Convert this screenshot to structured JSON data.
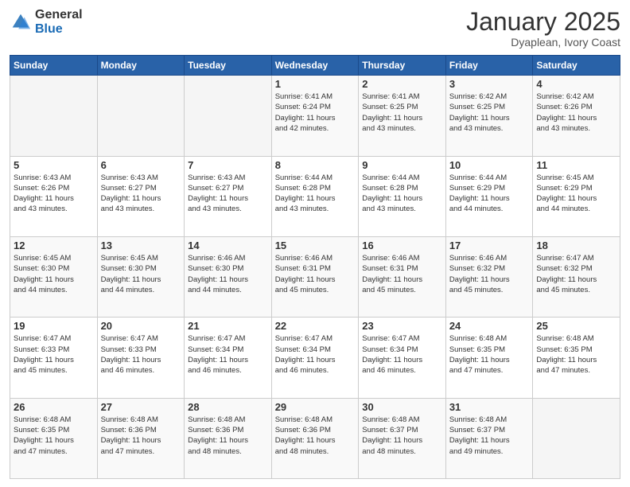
{
  "logo": {
    "general": "General",
    "blue": "Blue"
  },
  "title": {
    "month": "January 2025",
    "location": "Dyaplean, Ivory Coast"
  },
  "weekdays": [
    "Sunday",
    "Monday",
    "Tuesday",
    "Wednesday",
    "Thursday",
    "Friday",
    "Saturday"
  ],
  "weeks": [
    [
      {
        "day": "",
        "info": ""
      },
      {
        "day": "",
        "info": ""
      },
      {
        "day": "",
        "info": ""
      },
      {
        "day": "1",
        "info": "Sunrise: 6:41 AM\nSunset: 6:24 PM\nDaylight: 11 hours\nand 42 minutes."
      },
      {
        "day": "2",
        "info": "Sunrise: 6:41 AM\nSunset: 6:25 PM\nDaylight: 11 hours\nand 43 minutes."
      },
      {
        "day": "3",
        "info": "Sunrise: 6:42 AM\nSunset: 6:25 PM\nDaylight: 11 hours\nand 43 minutes."
      },
      {
        "day": "4",
        "info": "Sunrise: 6:42 AM\nSunset: 6:26 PM\nDaylight: 11 hours\nand 43 minutes."
      }
    ],
    [
      {
        "day": "5",
        "info": "Sunrise: 6:43 AM\nSunset: 6:26 PM\nDaylight: 11 hours\nand 43 minutes."
      },
      {
        "day": "6",
        "info": "Sunrise: 6:43 AM\nSunset: 6:27 PM\nDaylight: 11 hours\nand 43 minutes."
      },
      {
        "day": "7",
        "info": "Sunrise: 6:43 AM\nSunset: 6:27 PM\nDaylight: 11 hours\nand 43 minutes."
      },
      {
        "day": "8",
        "info": "Sunrise: 6:44 AM\nSunset: 6:28 PM\nDaylight: 11 hours\nand 43 minutes."
      },
      {
        "day": "9",
        "info": "Sunrise: 6:44 AM\nSunset: 6:28 PM\nDaylight: 11 hours\nand 43 minutes."
      },
      {
        "day": "10",
        "info": "Sunrise: 6:44 AM\nSunset: 6:29 PM\nDaylight: 11 hours\nand 44 minutes."
      },
      {
        "day": "11",
        "info": "Sunrise: 6:45 AM\nSunset: 6:29 PM\nDaylight: 11 hours\nand 44 minutes."
      }
    ],
    [
      {
        "day": "12",
        "info": "Sunrise: 6:45 AM\nSunset: 6:30 PM\nDaylight: 11 hours\nand 44 minutes."
      },
      {
        "day": "13",
        "info": "Sunrise: 6:45 AM\nSunset: 6:30 PM\nDaylight: 11 hours\nand 44 minutes."
      },
      {
        "day": "14",
        "info": "Sunrise: 6:46 AM\nSunset: 6:30 PM\nDaylight: 11 hours\nand 44 minutes."
      },
      {
        "day": "15",
        "info": "Sunrise: 6:46 AM\nSunset: 6:31 PM\nDaylight: 11 hours\nand 45 minutes."
      },
      {
        "day": "16",
        "info": "Sunrise: 6:46 AM\nSunset: 6:31 PM\nDaylight: 11 hours\nand 45 minutes."
      },
      {
        "day": "17",
        "info": "Sunrise: 6:46 AM\nSunset: 6:32 PM\nDaylight: 11 hours\nand 45 minutes."
      },
      {
        "day": "18",
        "info": "Sunrise: 6:47 AM\nSunset: 6:32 PM\nDaylight: 11 hours\nand 45 minutes."
      }
    ],
    [
      {
        "day": "19",
        "info": "Sunrise: 6:47 AM\nSunset: 6:33 PM\nDaylight: 11 hours\nand 45 minutes."
      },
      {
        "day": "20",
        "info": "Sunrise: 6:47 AM\nSunset: 6:33 PM\nDaylight: 11 hours\nand 46 minutes."
      },
      {
        "day": "21",
        "info": "Sunrise: 6:47 AM\nSunset: 6:34 PM\nDaylight: 11 hours\nand 46 minutes."
      },
      {
        "day": "22",
        "info": "Sunrise: 6:47 AM\nSunset: 6:34 PM\nDaylight: 11 hours\nand 46 minutes."
      },
      {
        "day": "23",
        "info": "Sunrise: 6:47 AM\nSunset: 6:34 PM\nDaylight: 11 hours\nand 46 minutes."
      },
      {
        "day": "24",
        "info": "Sunrise: 6:48 AM\nSunset: 6:35 PM\nDaylight: 11 hours\nand 47 minutes."
      },
      {
        "day": "25",
        "info": "Sunrise: 6:48 AM\nSunset: 6:35 PM\nDaylight: 11 hours\nand 47 minutes."
      }
    ],
    [
      {
        "day": "26",
        "info": "Sunrise: 6:48 AM\nSunset: 6:35 PM\nDaylight: 11 hours\nand 47 minutes."
      },
      {
        "day": "27",
        "info": "Sunrise: 6:48 AM\nSunset: 6:36 PM\nDaylight: 11 hours\nand 47 minutes."
      },
      {
        "day": "28",
        "info": "Sunrise: 6:48 AM\nSunset: 6:36 PM\nDaylight: 11 hours\nand 48 minutes."
      },
      {
        "day": "29",
        "info": "Sunrise: 6:48 AM\nSunset: 6:36 PM\nDaylight: 11 hours\nand 48 minutes."
      },
      {
        "day": "30",
        "info": "Sunrise: 6:48 AM\nSunset: 6:37 PM\nDaylight: 11 hours\nand 48 minutes."
      },
      {
        "day": "31",
        "info": "Sunrise: 6:48 AM\nSunset: 6:37 PM\nDaylight: 11 hours\nand 49 minutes."
      },
      {
        "day": "",
        "info": ""
      }
    ]
  ]
}
